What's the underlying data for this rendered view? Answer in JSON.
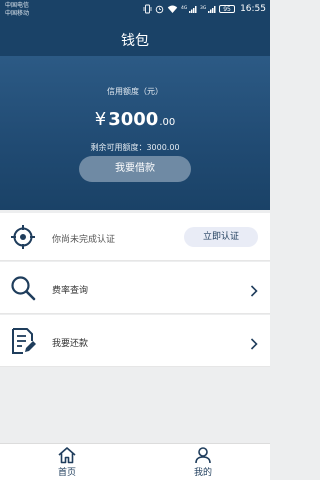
{
  "status_bar": {
    "carrier_1": "中国电信",
    "carrier_2": "中国移动",
    "signal_1": "4G",
    "signal_2": "3G",
    "battery": "95",
    "time": "16:55"
  },
  "header": {
    "title": "钱包"
  },
  "hero": {
    "limit_label": "信用额度（元）",
    "currency": "¥",
    "amount_int": "3000",
    "amount_dec": ".00",
    "remaining": "剩余可用额度：3000.00",
    "borrow_button": "我要借款"
  },
  "list": {
    "verify_text": "你尚未完成认证",
    "verify_button": "立即认证",
    "rates_label": "费率查询",
    "repay_label": "我要还款"
  },
  "tabs": [
    {
      "label": "首页",
      "icon": "home-icon"
    },
    {
      "label": "我的",
      "icon": "person-icon"
    }
  ],
  "colors": {
    "header": "#1a4267",
    "accent": "#1f3d5c",
    "button": "#6f8aa4"
  }
}
